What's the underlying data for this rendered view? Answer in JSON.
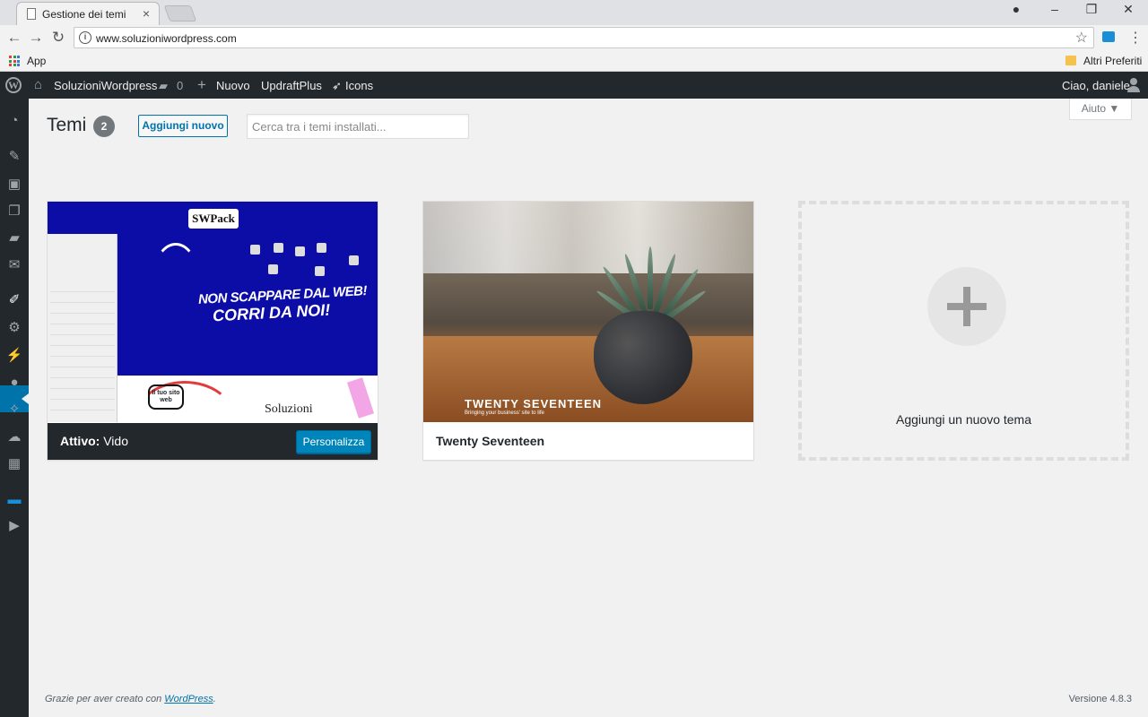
{
  "browser": {
    "tab_title": "Gestione dei temi",
    "url": "www.soluzioniwordpress.com",
    "bookmarks": {
      "apps": "App",
      "other": "Altri Preferiti"
    },
    "icons": [
      "back-icon",
      "forward-icon",
      "reload-icon",
      "info-icon",
      "star-icon",
      "menu-icon"
    ]
  },
  "adminbar": {
    "site": "SoluzioniWordpress",
    "comments_count": "0",
    "new": "Nuovo",
    "updraft": "UpdraftPlus",
    "icons": "Icons",
    "greeting": "Ciao, daniele"
  },
  "page": {
    "title": "Temi",
    "count": "2",
    "add_new": "Aggiungi nuovo",
    "search_placeholder": "Cerca tra i temi installati...",
    "help": "Aiuto ▼"
  },
  "themes": [
    {
      "name": "Vido",
      "active_label": "Attivo:",
      "customize": "Personalizza",
      "screenshot": {
        "logo": "SWPack",
        "headline1": "NON SCAPPARE DAL WEB!",
        "headline2": "CORRI DA NOI!",
        "bubble": "Il tuo sito web",
        "brand": "Soluzioni"
      }
    },
    {
      "name": "Twenty Seventeen",
      "screenshot": {
        "title": "TWENTY SEVENTEEN",
        "subtitle": "Bringing your business' site to life"
      }
    }
  ],
  "add_theme": {
    "label": "Aggiungi un nuovo tema"
  },
  "footer": {
    "thanks": "Grazie per aver creato con",
    "link": "WordPress",
    "version": "Versione 4.8.3"
  },
  "colors": {
    "adminbar": "#23282d",
    "accent": "#0073aa",
    "button": "#0085ba",
    "background": "#f1f1f1"
  }
}
